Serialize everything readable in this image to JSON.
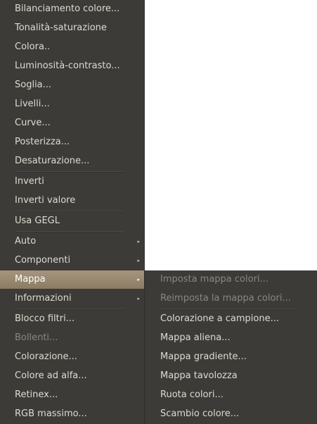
{
  "main_menu": {
    "items": [
      {
        "label": "Bilanciamento colore..."
      },
      {
        "label": "Tonalità-saturazione"
      },
      {
        "label": "Colora.."
      },
      {
        "label": "Luminosità-contrasto..."
      },
      {
        "label": "Soglia..."
      },
      {
        "label": "Livelli..."
      },
      {
        "label": "Curve..."
      },
      {
        "label": "Posterizza..."
      },
      {
        "label": "Desaturazione..."
      },
      {
        "label": "Inverti"
      },
      {
        "label": "Inverti valore"
      },
      {
        "label": "Usa GEGL"
      },
      {
        "label": "Auto"
      },
      {
        "label": "Componenti"
      },
      {
        "label": "Mappa"
      },
      {
        "label": "Informazioni"
      },
      {
        "label": "Blocco filtri..."
      },
      {
        "label": "Bollenti..."
      },
      {
        "label": "Colorazione..."
      },
      {
        "label": "Colore ad alfa..."
      },
      {
        "label": "Retinex..."
      },
      {
        "label": "RGB massimo..."
      }
    ],
    "arrow_glyph": "▸"
  },
  "sub_menu": {
    "items": [
      {
        "label": "Imposta mappa colori..."
      },
      {
        "label": "Reimposta la mappa colori..."
      },
      {
        "label": "Colorazione a campione..."
      },
      {
        "label": "Mappa aliena..."
      },
      {
        "label": "Mappa gradiente..."
      },
      {
        "label": "Mappa tavolozza"
      },
      {
        "label": "Ruota colori..."
      },
      {
        "label": "Scambio colore..."
      }
    ]
  },
  "colors": {
    "menu_bg": "#3c3b37",
    "menu_text": "#dfdbd2",
    "disabled_text": "#8a877f",
    "highlight_top": "#a4957f",
    "highlight_bottom": "#8c7c63"
  }
}
